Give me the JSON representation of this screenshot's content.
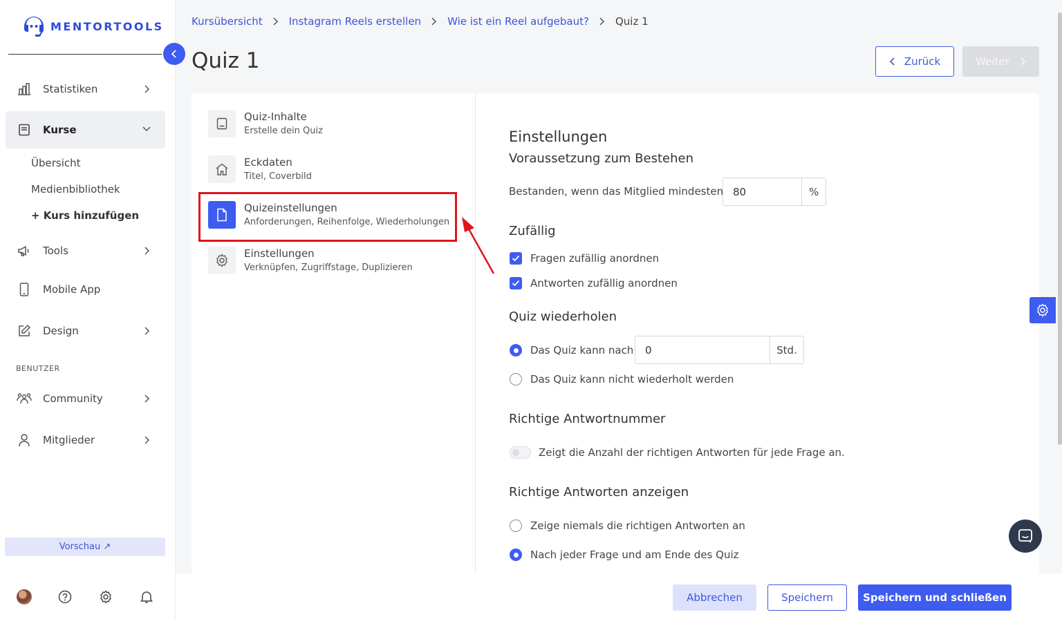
{
  "brand": {
    "name": "MENTORTOOLS",
    "accent": "#3f5cf0"
  },
  "sidebar": {
    "items": [
      {
        "label": "Statistiken",
        "icon": "bar-chart-icon"
      },
      {
        "label": "Kurse",
        "icon": "book-icon"
      },
      {
        "label": "Tools",
        "icon": "megaphone-icon"
      },
      {
        "label": "Mobile App",
        "icon": "mobile-icon"
      },
      {
        "label": "Design",
        "icon": "edit-icon"
      },
      {
        "label": "Community",
        "icon": "community-icon"
      },
      {
        "label": "Mitglieder",
        "icon": "user-icon"
      }
    ],
    "sub_items": [
      "Übersicht",
      "Medienbibliothek",
      "+ Kurs hinzufügen"
    ],
    "section_label": "BENUTZER",
    "preview": "Vorschau ↗"
  },
  "breadcrumb": [
    "Kursübersicht",
    "Instagram Reels erstellen",
    "Wie ist ein Reel aufgebaut?",
    "Quiz 1"
  ],
  "page_title": "Quiz 1",
  "nav_buttons": {
    "back": "Zurück",
    "next": "Weiter"
  },
  "steps": [
    {
      "title": "Quiz-Inhalte",
      "sub": "Erstelle dein Quiz",
      "icon": "book-icon"
    },
    {
      "title": "Eckdaten",
      "sub": "Titel, Coverbild",
      "icon": "home-icon"
    },
    {
      "title": "Quizeinstellungen",
      "sub": "Anforderungen, Reihenfolge, Wiederholungen",
      "icon": "document-icon"
    },
    {
      "title": "Einstellungen",
      "sub": "Verknüpfen, Zugriffstage, Duplizieren",
      "icon": "gear-icon"
    }
  ],
  "settings": {
    "heading": "Einstellungen",
    "pass_heading": "Voraussetzung zum Bestehen",
    "pass_label": "Bestanden, wenn das Mitglied mindestens",
    "pass_value": "80",
    "pass_unit": "%",
    "random_heading": "Zufällig",
    "random_questions": "Fragen zufällig anordnen",
    "random_answers": "Antworten zufällig anordnen",
    "repeat_heading": "Quiz wiederholen",
    "repeat_after": "Das Quiz kann nach",
    "repeat_value": "0",
    "repeat_unit": "Std.",
    "repeat_never": "Das Quiz kann nicht wiederholt werden",
    "correct_number_heading": "Richtige Antwortnummer",
    "correct_number_toggle": "Zeigt die Anzahl der richtigen Antworten für jede Frage an.",
    "show_correct_heading": "Richtige Antworten anzeigen",
    "show_never": "Zeige niemals die richtigen Antworten an",
    "show_after_each": "Nach jeder Frage und am Ende des Quiz"
  },
  "footer": {
    "cancel": "Abbrechen",
    "save": "Speichern",
    "save_close": "Speichern und schließen"
  }
}
